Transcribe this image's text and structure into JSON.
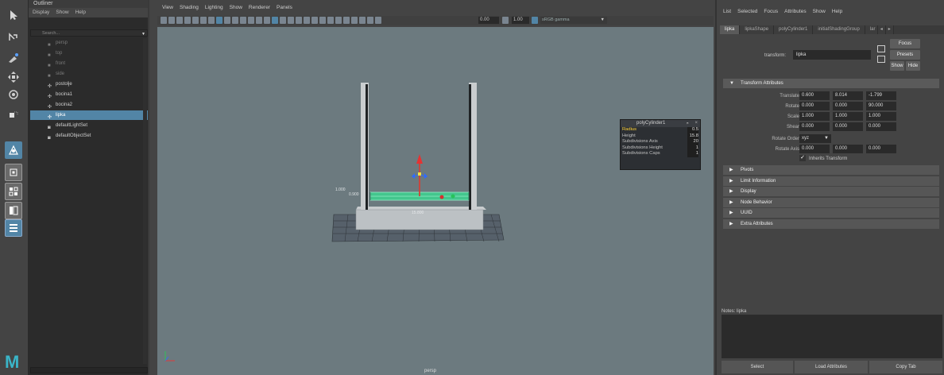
{
  "toolbox": {
    "tools": [
      {
        "name": "select-tool-icon"
      },
      {
        "name": "lasso-tool-icon"
      },
      {
        "name": "paint-select-tool-icon"
      },
      {
        "name": "move-tool-icon"
      },
      {
        "name": "rotate-tool-icon"
      },
      {
        "name": "scale-tool-icon"
      },
      {
        "name": "last-tool-icon"
      },
      {
        "name": "single-perspective-view-icon"
      },
      {
        "name": "four-view-layout-icon"
      },
      {
        "name": "two-view-layout-icon"
      },
      {
        "name": "outliner-persp-layout-icon"
      }
    ],
    "logo": "M"
  },
  "outliner": {
    "title": "Outliner",
    "menu": [
      "Display",
      "Show",
      "Help"
    ],
    "search_placeholder": "Search...",
    "items": [
      {
        "label": "persp",
        "icon": "camera-icon",
        "dim": true
      },
      {
        "label": "top",
        "icon": "camera-icon",
        "dim": true
      },
      {
        "label": "front",
        "icon": "camera-icon",
        "dim": true
      },
      {
        "label": "side",
        "icon": "camera-icon",
        "dim": true
      },
      {
        "label": "postolje",
        "icon": "transform-icon",
        "dim": false
      },
      {
        "label": "bocina1",
        "icon": "transform-icon",
        "dim": false
      },
      {
        "label": "bocina2",
        "icon": "transform-icon",
        "dim": false
      },
      {
        "label": "lipka",
        "icon": "transform-icon",
        "dim": false,
        "selected": true
      },
      {
        "label": "defaultLightSet",
        "icon": "set-icon",
        "dim": false
      },
      {
        "label": "defaultObjectSet",
        "icon": "set-icon",
        "dim": false
      }
    ]
  },
  "viewport": {
    "menu": [
      "View",
      "Shading",
      "Lighting",
      "Show",
      "Renderer",
      "Panels"
    ],
    "exposure": "0.00",
    "gamma": "1.00",
    "color_space": "sRGB gamma",
    "camera": "persp",
    "dim_left_1": "1.000",
    "dim_left_2": "0.900",
    "dim_bottom": "15.800",
    "colors": {
      "bg": "#6c7a7f",
      "cylinder": "#3fcf8f",
      "grid": "#4a4f52"
    }
  },
  "poly_box": {
    "title": "polyCylinder1",
    "rows": [
      {
        "label": "Radius",
        "value": "0.5",
        "highlight": true
      },
      {
        "label": "Height",
        "value": "15.8"
      },
      {
        "label": "Subdivisions Axis",
        "value": "20"
      },
      {
        "label": "Subdivisions Height",
        "value": "1"
      },
      {
        "label": "Subdivisions Caps",
        "value": "1"
      }
    ]
  },
  "attribute_editor": {
    "menu": [
      "List",
      "Selected",
      "Focus",
      "Attributes",
      "Show",
      "Help"
    ],
    "tabs": [
      "lipka",
      "lipkaShape",
      "polyCylinder1",
      "initialShadingGroup",
      "lar"
    ],
    "transform_label": "transform:",
    "transform_value": "lipka",
    "focus": "Focus",
    "presets": "Presets",
    "show": "Show",
    "hide": "Hide",
    "section_transform": "Transform Attributes",
    "attrs": [
      {
        "label": "Translate",
        "values": [
          "0.600",
          "8.014",
          "-1.799"
        ]
      },
      {
        "label": "Rotate",
        "values": [
          "0.000",
          "0.000",
          "90.000"
        ]
      },
      {
        "label": "Scale",
        "values": [
          "1.000",
          "1.000",
          "1.000"
        ]
      },
      {
        "label": "Shear",
        "values": [
          "0.000",
          "0.000",
          "0.000"
        ]
      }
    ],
    "rotate_order_label": "Rotate Order",
    "rotate_order_value": "xyz",
    "rotate_axis_label": "Rotate Axis",
    "rotate_axis_values": [
      "0.000",
      "0.000",
      "0.000"
    ],
    "inherits_label": "Inherits Transform",
    "collapsed_sections": [
      "Pivots",
      "Limit Information",
      "Display",
      "Node Behavior",
      "UUID",
      "Extra Attributes"
    ],
    "notes_label": "Notes: lipka",
    "buttons": {
      "select": "Select",
      "load": "Load Attributes",
      "copy": "Copy Tab"
    }
  }
}
